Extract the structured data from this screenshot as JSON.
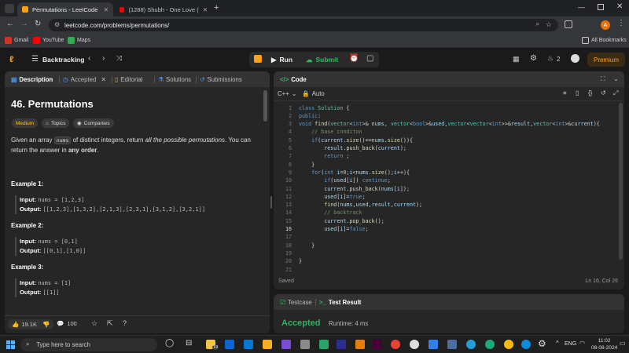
{
  "browser": {
    "tabs": [
      {
        "label": "Permutations - LeetCode",
        "active": true
      },
      {
        "label": "(1288) Shubh - One Love (",
        "active": false
      }
    ],
    "url": "leetcode.com/problems/permutations/",
    "profile_initial": "A",
    "bookmarks": [
      {
        "label": "Gmail",
        "icon": "gmail-icon"
      },
      {
        "label": "YouTube",
        "icon": "youtube-icon"
      },
      {
        "label": "Maps",
        "icon": "maps-icon"
      }
    ],
    "all_bookmarks": "All Bookmarks"
  },
  "nav": {
    "list_title": "Backtracking",
    "run": "Run",
    "submit": "Submit",
    "streak": "2",
    "premium": "Premium"
  },
  "left_panel": {
    "tabs": [
      "Description",
      "Accepted",
      "Editorial",
      "Solutions",
      "Submissions"
    ],
    "problem_title": "46. Permutations",
    "difficulty": "Medium",
    "topics": "Topics",
    "companies": "Companies",
    "desc_1": "Given an array ",
    "desc_code": "nums",
    "desc_2": " of distinct integers, return ",
    "desc_em": "all the possible permutations",
    "desc_3": ". You can return the answer in ",
    "desc_bold": "any order",
    "desc_4": ".",
    "examples": [
      {
        "title": "Example 1:",
        "input_label": "Input:",
        "input": "nums = [1,2,3]",
        "output_label": "Output:",
        "output": "[[1,2,3],[1,3,2],[2,1,3],[2,3,1],[3,1,2],[3,2,1]]"
      },
      {
        "title": "Example 2:",
        "input_label": "Input:",
        "input": "nums = [0,1]",
        "output_label": "Output:",
        "output": "[[0,1],[1,0]]"
      },
      {
        "title": "Example 3:",
        "input_label": "Input:",
        "input": "nums = [1]",
        "output_label": "Output:",
        "output": "[[1]]"
      }
    ],
    "likes": "19.1K",
    "comments": "100"
  },
  "code_panel": {
    "title": "Code",
    "language": "C++",
    "format": "Auto",
    "status": "Saved",
    "cursor": "Ln 16, Col 26",
    "lines": [
      {
        "n": "1",
        "t": "class Solution {"
      },
      {
        "n": "2",
        "t": "public:"
      },
      {
        "n": "3",
        "t": "void find(vector<int>& nums, vector<bool>&used,vector<vector<int>>&result,vector<int>&current){"
      },
      {
        "n": "4",
        "t": "    // base conditon"
      },
      {
        "n": "5",
        "t": "    if(current.size()==nums.size()){"
      },
      {
        "n": "6",
        "t": "        result.push_back(current);"
      },
      {
        "n": "7",
        "t": "        return ;"
      },
      {
        "n": "8",
        "t": "    }"
      },
      {
        "n": "9",
        "t": "    for(int i=0;i<nums.size();i++){"
      },
      {
        "n": "10",
        "t": "        if(used[i]) continue;"
      },
      {
        "n": "11",
        "t": "        current.push_back(nums[i]);"
      },
      {
        "n": "12",
        "t": "        used[i]=true;"
      },
      {
        "n": "13",
        "t": "        find(nums,used,result,current);"
      },
      {
        "n": "14",
        "t": "        // backtrack"
      },
      {
        "n": "15",
        "t": "        current.pop_back();"
      },
      {
        "n": "16",
        "t": "        used[i]=false;"
      },
      {
        "n": "17",
        "t": ""
      },
      {
        "n": "18",
        "t": "    }"
      },
      {
        "n": "19",
        "t": ""
      },
      {
        "n": "20",
        "t": "}"
      },
      {
        "n": "21",
        "t": ""
      }
    ]
  },
  "result_panel": {
    "tab_testcase": "Testcase",
    "tab_result": "Test Result",
    "status": "Accepted",
    "runtime": "Runtime: 4 ms"
  },
  "taskbar": {
    "search_placeholder": "Type here to search",
    "badge": "19",
    "lang": "ENG",
    "time": "11:02",
    "date": "08-08-2024"
  },
  "colors": {
    "accent_orange": "#ffa116",
    "accent_green": "#2cbb5d",
    "accepted_green": "#2db55d"
  }
}
